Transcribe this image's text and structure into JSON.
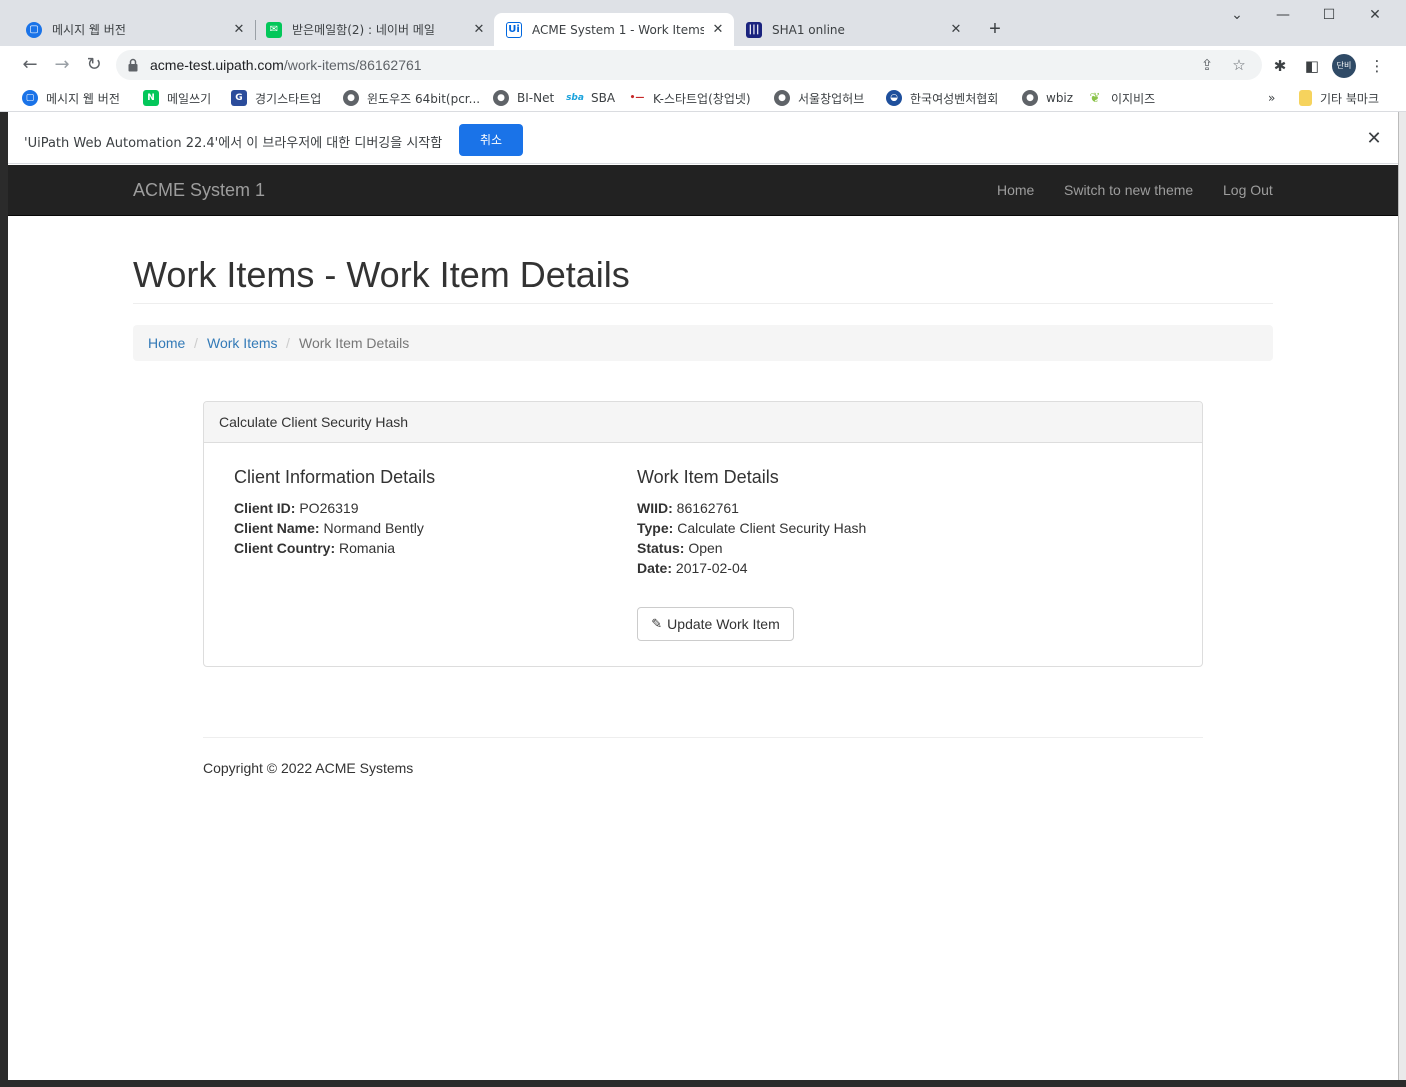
{
  "browser": {
    "tabs": [
      {
        "title": "메시지 웹 버전",
        "icon": "messages-icon",
        "color": "#1a73e8",
        "active": false
      },
      {
        "title": "받은메일함(2) : 네이버 메일",
        "icon": "naver-mail-icon",
        "color": "#03c75a",
        "active": false
      },
      {
        "title": "ACME System 1 - Work Items",
        "icon": "uipath-icon",
        "color": "#0067df",
        "active": true
      },
      {
        "title": "SHA1 online",
        "icon": "sha1-icon",
        "color": "#1a237e",
        "active": false
      }
    ],
    "url_host": "acme-test.uipath.com",
    "url_path": "/work-items/86162761",
    "bookmarks": [
      {
        "label": "메시지 웹 버전",
        "icon": "messages-icon",
        "color": "#1a73e8"
      },
      {
        "label": "메일쓰기",
        "icon": "naver-icon",
        "color": "#03c75a"
      },
      {
        "label": "경기스타트업",
        "icon": "gyeonggi-icon",
        "color": "#2b4c9b"
      },
      {
        "label": "윈도우즈 64bit(pcr...",
        "icon": "globe-icon",
        "color": "#5f6368"
      },
      {
        "label": "BI-Net",
        "icon": "globe-icon",
        "color": "#5f6368"
      },
      {
        "label": "SBA",
        "icon": "sba-icon",
        "color": "#1ca3dc"
      },
      {
        "label": "K-스타트업(창업넷)",
        "icon": "kstartup-icon",
        "color": "#c62828"
      },
      {
        "label": "서울창업허브",
        "icon": "globe-icon",
        "color": "#5f6368"
      },
      {
        "label": "한국여성벤처협회",
        "icon": "kovwa-icon",
        "color": "#1e4f9c"
      },
      {
        "label": "wbiz",
        "icon": "globe-icon",
        "color": "#5f6368"
      },
      {
        "label": "이지비즈",
        "icon": "easybiz-icon",
        "color": "#8bc34a"
      }
    ],
    "bookmarks_overflow": "»",
    "other_bookmarks": "기타 북마크",
    "profile_initials": "단비"
  },
  "infobar": {
    "message": "'UiPath Web Automation 22.4'에서 이 브라우저에 대한 디버깅을 시작함",
    "cancel_label": "취소"
  },
  "acme": {
    "brand": "ACME System 1",
    "nav": {
      "home": "Home",
      "switch_theme": "Switch to new theme",
      "logout": "Log Out"
    },
    "page_title": "Work Items - Work Item Details",
    "breadcrumb": {
      "home": "Home",
      "work_items": "Work Items",
      "current": "Work Item Details",
      "separator": "/"
    },
    "panel_title": "Calculate Client Security Hash",
    "client": {
      "heading": "Client Information Details",
      "id_label": "Client ID:",
      "id_value": "PO26319",
      "name_label": "Client Name:",
      "name_value": "Normand Bently",
      "country_label": "Client Country:",
      "country_value": "Romania"
    },
    "work_item": {
      "heading": "Work Item Details",
      "wiid_label": "WIID:",
      "wiid_value": "86162761",
      "type_label": "Type:",
      "type_value": "Calculate Client Security Hash",
      "status_label": "Status:",
      "status_value": "Open",
      "date_label": "Date:",
      "date_value": "2017-02-04"
    },
    "update_button": "Update Work Item",
    "copyright": "Copyright © 2022 ACME Systems"
  }
}
